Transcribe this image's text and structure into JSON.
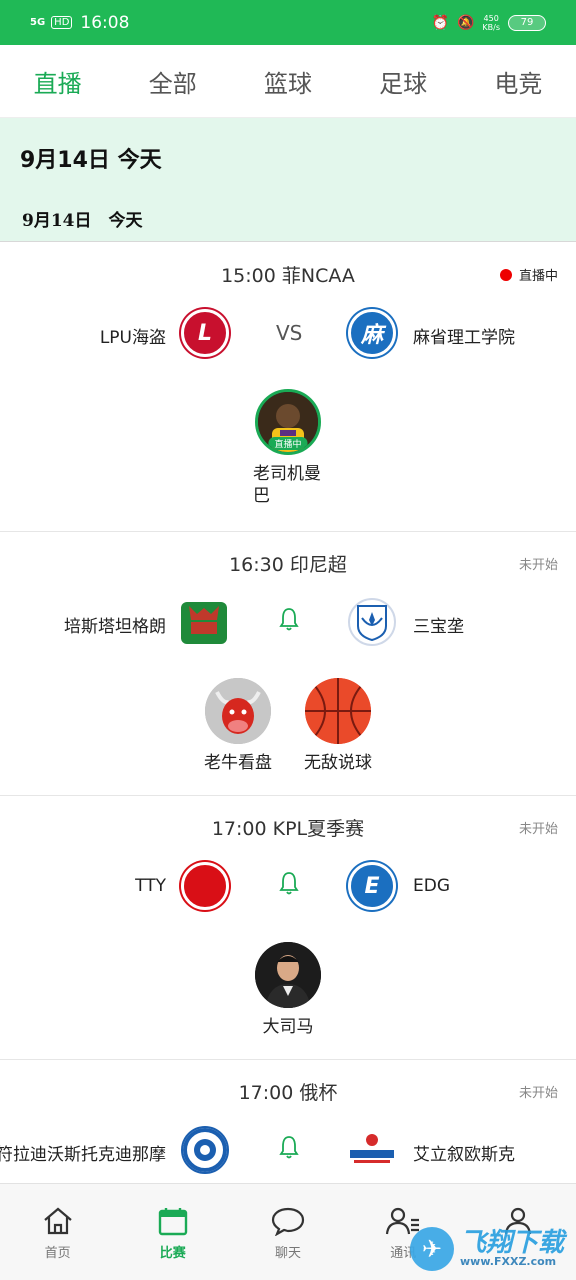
{
  "status_bar": {
    "network": "5G",
    "hd": "HD",
    "time": "16:08",
    "speed_value": "450",
    "speed_unit": "KB/s",
    "battery": "79"
  },
  "tabs": [
    {
      "label": "直播",
      "active": true
    },
    {
      "label": "全部",
      "active": false
    },
    {
      "label": "篮球",
      "active": false
    },
    {
      "label": "足球",
      "active": false
    },
    {
      "label": "电竞",
      "active": false
    }
  ],
  "date_header": {
    "main": "9月14日 今天",
    "sub": "9月14日　今天"
  },
  "matches": [
    {
      "header": "15:00 菲NCAA",
      "status": "直播中",
      "home": {
        "name": "LPU海盗",
        "logo_letter": "L"
      },
      "away": {
        "name": "麻省理工学院",
        "logo_letter": "麻"
      },
      "vs": "VS",
      "hosts": [
        {
          "name": "老司机曼巴",
          "live_tag": "直播中"
        }
      ]
    },
    {
      "header": "16:30 印尼超",
      "status": "未开始",
      "home": {
        "name": "培斯塔坦格朗"
      },
      "away": {
        "name": "三宝垄"
      },
      "hosts": [
        {
          "name": "老牛看盘"
        },
        {
          "name": "无敌说球"
        }
      ]
    },
    {
      "header": "17:00 KPL夏季赛",
      "status": "未开始",
      "home": {
        "name": "TTY"
      },
      "away": {
        "name": "EDG",
        "logo_letter": "E"
      },
      "hosts": [
        {
          "name": "大司马"
        }
      ]
    },
    {
      "header": "17:00 俄杯",
      "status": "未开始",
      "home": {
        "name": "符拉迪沃斯托克迪那摩"
      },
      "away": {
        "name": "艾立叙欧斯克"
      }
    }
  ],
  "bottom_nav": [
    {
      "label": "首页",
      "icon": "home-icon",
      "active": false
    },
    {
      "label": "比赛",
      "icon": "calendar-icon",
      "active": true
    },
    {
      "label": "聊天",
      "icon": "chat-icon",
      "active": false
    },
    {
      "label": "通讯",
      "icon": "contacts-icon",
      "active": false
    },
    {
      "label": "",
      "icon": "profile-icon",
      "active": false
    }
  ],
  "watermark": {
    "text": "飞翔下载",
    "url": "www.FXXZ.com"
  },
  "colors": {
    "brand_green": "#20b956",
    "live_red": "#e00000",
    "date_band": "#e3f7ec"
  }
}
